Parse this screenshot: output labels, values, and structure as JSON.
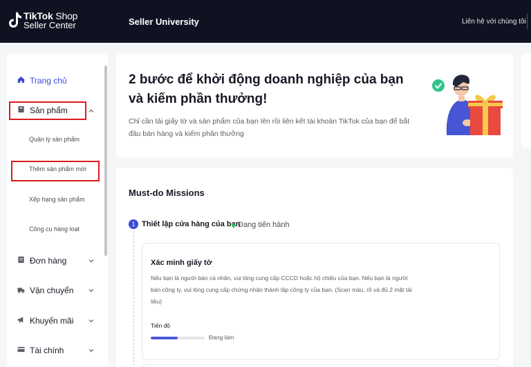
{
  "header": {
    "brand_name": "TikTok",
    "brand_shop": "Shop",
    "brand_sub": "Seller Center",
    "title": "Seller University",
    "contact": "Liên hệ với chúng tôi"
  },
  "sidebar": {
    "items": [
      {
        "label": "Trang chủ",
        "icon": "home-icon"
      },
      {
        "label": "Sản phẩm",
        "icon": "product-icon"
      },
      {
        "label": "Đơn hàng",
        "icon": "order-icon"
      },
      {
        "label": "Vận chuyển",
        "icon": "truck-icon"
      },
      {
        "label": "Khuyến mãi",
        "icon": "megaphone-icon"
      },
      {
        "label": "Tài chính",
        "icon": "finance-icon"
      }
    ],
    "product_subitems": [
      "Quản lý sản phẩm",
      "Thêm sản phẩm mới",
      "Xếp hạng sản phẩm",
      "Công cụ hàng loạt"
    ]
  },
  "hero": {
    "title": "2 bước để khởi động doanh nghiệp của bạn và kiếm phần thưởng!",
    "description": "Chỉ cần tải giấy tờ và sản phẩm của bạn lên rồi liên kết tài khoản TikTok của bạn để bắt đầu bán hàng và kiếm phần thưởng"
  },
  "missions": {
    "title": "Must-do Missions",
    "step": {
      "number": "1",
      "label": "Thiết lập cửa hàng của bạn",
      "status": "Đang tiến hành",
      "status_color": "#20c052"
    },
    "task": {
      "title": "Xác minh giấy tờ",
      "description": "Nếu bạn là người bán cá nhân, vui lòng cung cấp CCCD hoặc hộ chiếu của bạn. Nếu bạn là người bán công ty, vui lòng cung cấp chứng nhận thành lập công ty của bạn. (Scan màu, rõ và đủ 2 mặt tài liệu)",
      "progress_label": "Tiến độ",
      "progress_status": "Đang làm",
      "progress_fraction": 0.5
    }
  },
  "colors": {
    "header_bg": "#0f1221",
    "accent": "#3b4bd6",
    "highlight_box": "#e0191c"
  }
}
